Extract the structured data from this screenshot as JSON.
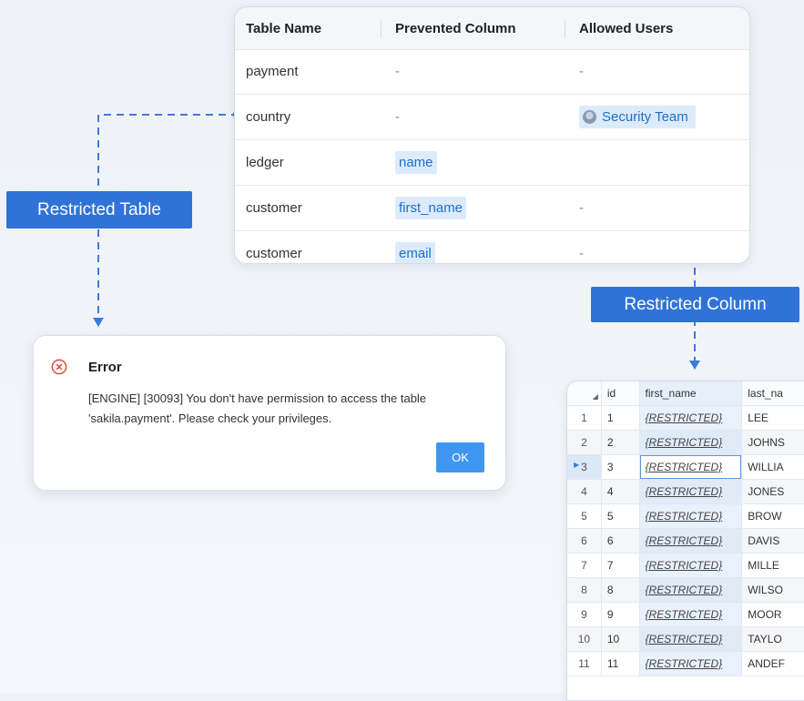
{
  "policy_table": {
    "headers": [
      "Table Name",
      "Prevented Column",
      "Allowed Users"
    ],
    "rows": [
      {
        "table": "payment",
        "column": "-",
        "users": "-"
      },
      {
        "table": "country",
        "column": "-",
        "users": "Security Team"
      },
      {
        "table": "ledger",
        "column": "name",
        "users": ""
      },
      {
        "table": "customer",
        "column": "first_name",
        "users": "-"
      },
      {
        "table": "customer",
        "column": "email",
        "users": "-"
      }
    ]
  },
  "labels": {
    "restricted_table": "Restricted Table",
    "restricted_column": "Restricted Column"
  },
  "error_dialog": {
    "title": "Error",
    "message": "[ENGINE] [30093] You don't have permission to access the table 'sakila.payment'. Please check your privileges.",
    "ok_label": "OK"
  },
  "result_grid": {
    "columns": [
      "id",
      "first_name",
      "last_na"
    ],
    "rows": [
      {
        "rn": "1",
        "id": "1",
        "first_name": "{RESTRICTED}",
        "last_name": "LEE"
      },
      {
        "rn": "2",
        "id": "2",
        "first_name": "{RESTRICTED}",
        "last_name": "JOHNS"
      },
      {
        "rn": "3",
        "id": "3",
        "first_name": "{RESTRICTED}",
        "last_name": "WILLIA"
      },
      {
        "rn": "4",
        "id": "4",
        "first_name": "{RESTRICTED}",
        "last_name": "JONES"
      },
      {
        "rn": "5",
        "id": "5",
        "first_name": "{RESTRICTED}",
        "last_name": "BROW"
      },
      {
        "rn": "6",
        "id": "6",
        "first_name": "{RESTRICTED}",
        "last_name": "DAVIS"
      },
      {
        "rn": "7",
        "id": "7",
        "first_name": "{RESTRICTED}",
        "last_name": "MILLE"
      },
      {
        "rn": "8",
        "id": "8",
        "first_name": "{RESTRICTED}",
        "last_name": "WILSO"
      },
      {
        "rn": "9",
        "id": "9",
        "first_name": "{RESTRICTED}",
        "last_name": "MOOR"
      },
      {
        "rn": "10",
        "id": "10",
        "first_name": "{RESTRICTED}",
        "last_name": "TAYLO"
      },
      {
        "rn": "11",
        "id": "11",
        "first_name": "{RESTRICTED}",
        "last_name": "ANDEF"
      }
    ]
  },
  "colors": {
    "accent": "#2f73d8",
    "connector": "#3b7be0",
    "chip_bg": "#dcebfa",
    "error": "#e0463c"
  },
  "icons": [
    "error-icon",
    "user-group-icon",
    "sort-icon"
  ]
}
